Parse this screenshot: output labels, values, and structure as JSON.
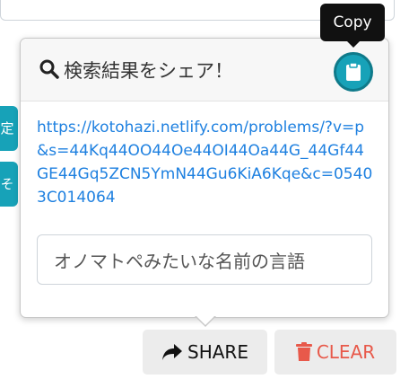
{
  "tooltip": {
    "text": "Copy"
  },
  "side_tabs": {
    "top_glyph": "定",
    "bottom_glyph": "そ"
  },
  "popover": {
    "title": "検索結果をシェア！",
    "share_url": "https://kotohazi.netlify.com/problems/?v=p&s=44Kq44OO44Oe44OI44Oa44G_44Gf44GE44Gq5ZCN5YmN44Gu6KiA6Kqe&c=05403C014064",
    "input_value": "オノマトペみたいな名前の言語"
  },
  "buttons": {
    "share_label": "SHARE",
    "clear_label": "CLEAR"
  },
  "icons": {
    "search": "search-icon",
    "copy": "clipboard-icon",
    "share": "share-arrow-icon",
    "clear": "trash-icon"
  },
  "colors": {
    "accent": "#17a2b8",
    "link": "#1e80e0",
    "danger": "#e8594a",
    "tooltip_bg": "#111111"
  }
}
